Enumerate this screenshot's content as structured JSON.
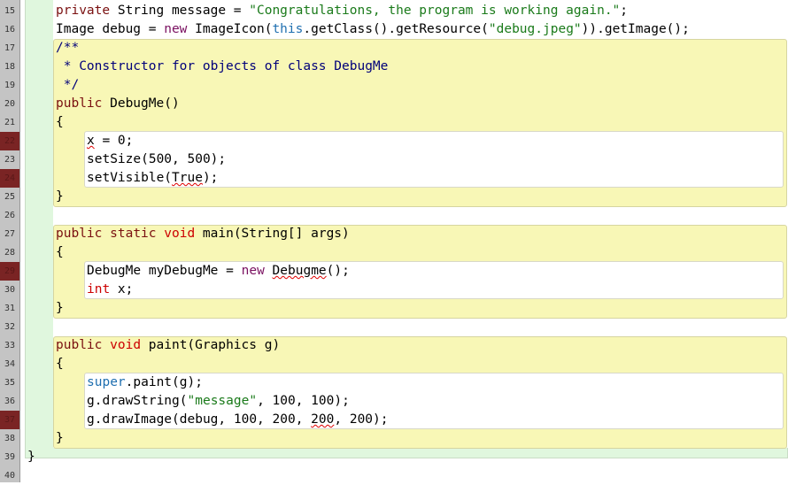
{
  "editor": {
    "first_line": 15,
    "breakpoints": [
      22,
      24,
      29,
      37
    ],
    "lines": [
      {
        "n": 15,
        "indent": 1,
        "tokens": [
          [
            "private",
            "kw"
          ],
          [
            " String message = ",
            ""
          ],
          [
            "\"Congratulations, the program is working again.\"",
            "str"
          ],
          [
            ";",
            ""
          ]
        ]
      },
      {
        "n": 16,
        "indent": 1,
        "tokens": [
          [
            "Image debug = ",
            ""
          ],
          [
            "new",
            "new"
          ],
          [
            " ImageIcon(",
            ""
          ],
          [
            "this",
            "sup"
          ],
          [
            ".getClass().getResource(",
            ""
          ],
          [
            "\"debug.jpeg\"",
            "str"
          ],
          [
            ")).getImage();",
            ""
          ]
        ]
      },
      {
        "n": 17,
        "indent": 1,
        "tokens": [
          [
            "/**",
            "cm"
          ]
        ]
      },
      {
        "n": 18,
        "indent": 1,
        "tokens": [
          [
            " * Constructor for objects of class DebugMe",
            "cm"
          ]
        ]
      },
      {
        "n": 19,
        "indent": 1,
        "tokens": [
          [
            " */",
            "cm"
          ]
        ]
      },
      {
        "n": 20,
        "indent": 1,
        "tokens": [
          [
            "public",
            "kw"
          ],
          [
            " DebugMe()",
            ""
          ]
        ]
      },
      {
        "n": 21,
        "indent": 1,
        "tokens": [
          [
            "{",
            ""
          ]
        ]
      },
      {
        "n": 22,
        "indent": 2,
        "tokens": [
          [
            "x",
            "err"
          ],
          [
            " = 0;",
            ""
          ]
        ]
      },
      {
        "n": 23,
        "indent": 2,
        "tokens": [
          [
            "setSize(500, 500);",
            ""
          ]
        ]
      },
      {
        "n": 24,
        "indent": 2,
        "tokens": [
          [
            "setVisible(",
            ""
          ],
          [
            "True",
            "err"
          ],
          [
            ");",
            ""
          ]
        ]
      },
      {
        "n": 25,
        "indent": 1,
        "tokens": [
          [
            "}",
            ""
          ]
        ]
      },
      {
        "n": 26,
        "indent": 1,
        "tokens": []
      },
      {
        "n": 27,
        "indent": 1,
        "tokens": [
          [
            "public",
            "kw"
          ],
          [
            " ",
            ""
          ],
          [
            "static",
            "kw"
          ],
          [
            " ",
            ""
          ],
          [
            "void",
            "ty"
          ],
          [
            " main(String[] args)",
            ""
          ]
        ]
      },
      {
        "n": 28,
        "indent": 1,
        "tokens": [
          [
            "{",
            ""
          ]
        ]
      },
      {
        "n": 29,
        "indent": 2,
        "tokens": [
          [
            "DebugMe myDebugMe = ",
            ""
          ],
          [
            "new",
            "new"
          ],
          [
            " ",
            ""
          ],
          [
            "Debugme",
            "err"
          ],
          [
            "();",
            ""
          ]
        ]
      },
      {
        "n": 30,
        "indent": 2,
        "tokens": [
          [
            "int",
            "ty"
          ],
          [
            " x;",
            ""
          ]
        ]
      },
      {
        "n": 31,
        "indent": 1,
        "tokens": [
          [
            "}",
            ""
          ]
        ]
      },
      {
        "n": 32,
        "indent": 1,
        "tokens": []
      },
      {
        "n": 33,
        "indent": 1,
        "tokens": [
          [
            "public",
            "kw"
          ],
          [
            " ",
            ""
          ],
          [
            "void",
            "ty"
          ],
          [
            " paint(Graphics g)",
            ""
          ]
        ]
      },
      {
        "n": 34,
        "indent": 1,
        "tokens": [
          [
            "{",
            ""
          ]
        ]
      },
      {
        "n": 35,
        "indent": 2,
        "tokens": [
          [
            "super",
            "sup"
          ],
          [
            ".paint(g);",
            ""
          ]
        ]
      },
      {
        "n": 36,
        "indent": 2,
        "tokens": [
          [
            "g.drawString(",
            ""
          ],
          [
            "\"message\"",
            "str"
          ],
          [
            ", 100, 100);",
            ""
          ]
        ]
      },
      {
        "n": 37,
        "indent": 2,
        "tokens": [
          [
            "g.drawImage(debug, 100, 200, ",
            ""
          ],
          [
            "200",
            "err"
          ],
          [
            ", 200);",
            ""
          ]
        ]
      },
      {
        "n": 38,
        "indent": 1,
        "tokens": [
          [
            "}",
            ""
          ]
        ]
      },
      {
        "n": 39,
        "indent": 0,
        "tokens": [
          [
            "}",
            ""
          ]
        ]
      },
      {
        "n": 40,
        "indent": 0,
        "tokens": []
      }
    ]
  }
}
